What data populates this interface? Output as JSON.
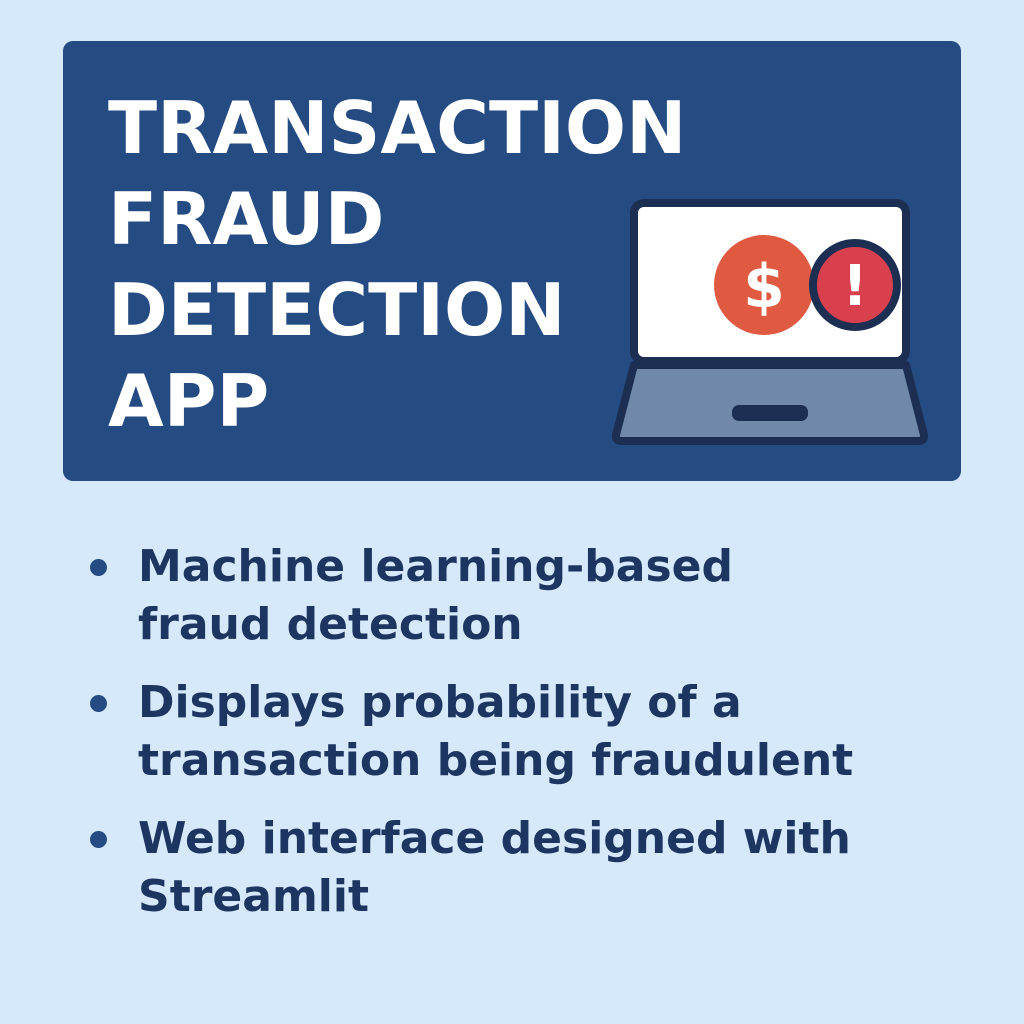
{
  "banner": {
    "title_lines": [
      "TRANSACTION",
      "FRAUD",
      "DETECTION",
      "APP"
    ],
    "icon": {
      "name": "laptop-icon",
      "screen_badges": [
        "dollar-sign-icon",
        "exclamation-alert-icon"
      ],
      "dollar_glyph": "$",
      "alert_glyph": "!"
    }
  },
  "bullets": [
    {
      "lines": [
        "Machine learning-based",
        "fraud detection"
      ]
    },
    {
      "lines": [
        "Displays probability of a",
        "transaction being fraudulent"
      ]
    },
    {
      "lines": [
        "Web interface designed with",
        "Streamlit"
      ]
    }
  ],
  "colors": {
    "background": "#d6e9fb",
    "banner": "#244b82",
    "title_text": "#ffffff",
    "bullet_text": "#1c3561",
    "dollar_circle": "#e05a42",
    "alert_circle": "#d8404e",
    "laptop_outline": "#1c2e52",
    "laptop_base": "#7189a8"
  }
}
